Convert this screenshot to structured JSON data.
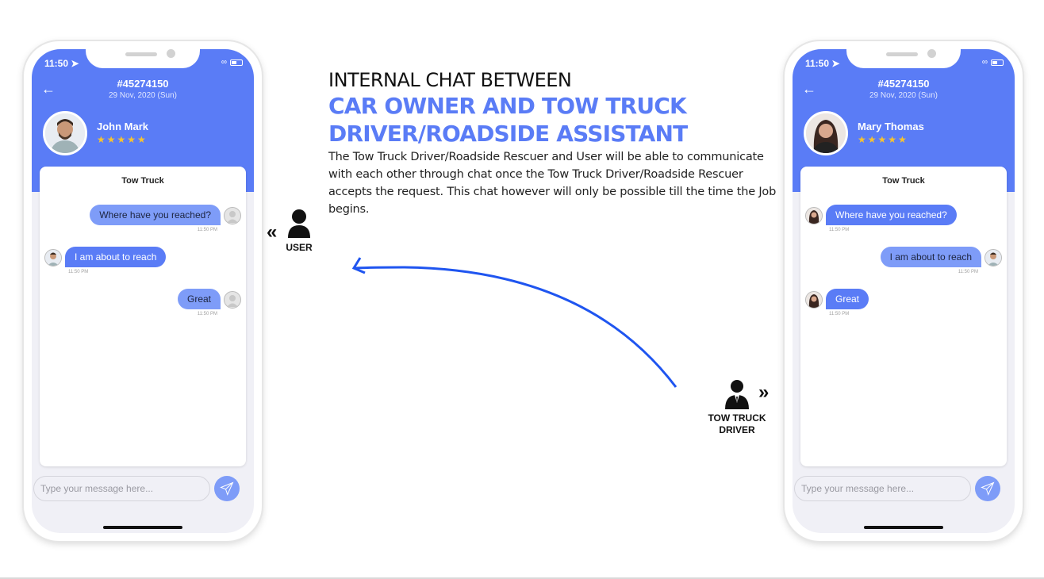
{
  "headline": {
    "line1": "INTERNAL CHAT BETWEEN",
    "line2": "CAR OWNER AND TOW TRUCK",
    "line3": "DRIVER/ROADSIDE ASSISTANT",
    "description": "The Tow Truck Driver/Roadside Rescuer and User will be able to communicate with each other through chat once the Tow Truck Driver/Roadside Rescuer accepts the request. This chat however will only be possible till the time the Job begins."
  },
  "roles": {
    "user": {
      "label": "USER",
      "icon": "person-icon",
      "chevron": "«"
    },
    "driver": {
      "label_line1": "TOW TRUCK",
      "label_line2": "DRIVER",
      "icon": "businessman-icon",
      "chevron": "»"
    }
  },
  "colors": {
    "accent": "#5a7cf6",
    "bubble_light": "#7e9cf8",
    "stars": "#f7c330",
    "arrow": "#1f55f0"
  },
  "phones": [
    {
      "status_time": "11:50",
      "order_id": "#45274150",
      "date": "29 Nov, 2020 (Sun)",
      "contact_name": "John Mark",
      "rating": "5 of 5",
      "stars": "★★★★★",
      "chat_title": "Tow Truck",
      "messages": [
        {
          "text": "Where have you reached?",
          "side": "out",
          "time": "11:50 PM"
        },
        {
          "text": "I am about to reach",
          "side": "in",
          "time": "11:50 PM"
        },
        {
          "text": "Great",
          "side": "out",
          "time": "11:50 PM"
        }
      ],
      "input_placeholder": "Type your message here..."
    },
    {
      "status_time": "11:50",
      "order_id": "#45274150",
      "date": "29 Nov, 2020 (Sun)",
      "contact_name": "Mary Thomas",
      "rating": "5 of 5",
      "stars": "★★★★★",
      "chat_title": "Tow Truck",
      "messages": [
        {
          "text": "Where have you reached?",
          "side": "in",
          "time": "11:50 PM"
        },
        {
          "text": "I am about to reach",
          "side": "out",
          "time": "11:50 PM"
        },
        {
          "text": "Great",
          "side": "in",
          "time": "11:50 PM"
        }
      ],
      "input_placeholder": "Type your message here..."
    }
  ]
}
